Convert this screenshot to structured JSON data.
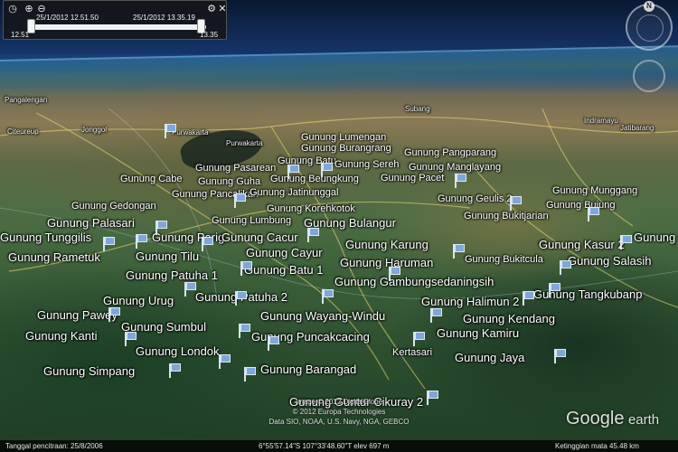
{
  "time_slider": {
    "start_datetime": "25/1/2012  12.51.50",
    "end_datetime": "25/1/2012  13.35.19",
    "start_time": "12.51",
    "end_time": "13.35",
    "range_fraction": [
      0.0,
      1.0
    ],
    "icons": [
      "clock-icon",
      "zoom-in-icon",
      "zoom-out-icon",
      "settings-icon",
      "close-icon"
    ]
  },
  "navigation": {
    "north_label": "N"
  },
  "place_names": {
    "pangalengan": "Pangalengan",
    "cileungsi": "Citeureup",
    "jonggol": "Jonggol",
    "purwakarta": "Purwakarta",
    "subang": "Subang",
    "indramayu": "Indramayu",
    "jatibarang": "Jatibarang",
    "kertasari": "Kertasari"
  },
  "mountains": [
    "Gunung Lumengan",
    "Gunung Burangrang",
    "Gunung Pangparang",
    "Gunung Batu",
    "Gunung Pasarean",
    "Gunung Sereh",
    "Gunung Manglayang",
    "Gunung Cabe",
    "Gunung Guha",
    "Gunung Beungkung",
    "Gunung Pacet",
    "Gunung Pancalikan",
    "Gunung Jatinunggal",
    "Gunung Geulis 2",
    "Gunung Munggang",
    "Gunung Gedongan",
    "Gunung Korehkotok",
    "Gunung Bujung",
    "Gunung Bukitjarian",
    "Gunung Palasari",
    "Gunung Lumbung",
    "Gunung Bulangur",
    "Gunung Tunggilis",
    "Gunung Parig",
    "Gunung Cacur",
    "Gunung Karung",
    "Gunung Kasur 2",
    "Gunung Ma",
    "Gunung Rametuk",
    "Gunung Tilu",
    "Gunung Cayur",
    "Gunung Haruman",
    "Gunung Bukitcula",
    "Gunung Salasih",
    "Gunung Patuha 1",
    "Gunung Batu 1",
    "Gunung Gambungsedaningsih",
    "Gunung Urug",
    "Gunung Patuha 2",
    "Gunung Halimun 2",
    "Gunung Tangkubanp",
    "Gunung Pawey",
    "Gunung Wayang-Windu",
    "Gunung Kendang",
    "Gunung Sumbul",
    "Gunung Kanti",
    "Gunung Puncakcacing",
    "Gunung Kamiru",
    "Gunung Londok",
    "Kertasari",
    "Gunung Jaya",
    "Gunung Simpang",
    "Gunung Barangad",
    "Gunung Guntur Cikuray 2"
  ],
  "credits": {
    "line1": "Image © 2012 DigitalGlobe",
    "line2": "© 2012 Europa Technologies",
    "line3": "Data SIO, NOAA, U.S. Navy, NGA, GEBCO"
  },
  "status_bar": {
    "imagery_date": "Tanggal pencitraan: 25/8/2006",
    "coordinates": "6°55'57.14\"S  107°33'48.60\"T  elev   697 m",
    "eye_alt": "Ketinggian mata    45.48 km"
  },
  "logo": {
    "google": "Google",
    "earth": "earth"
  },
  "colors": {
    "pin_fill": "#7fa7d8",
    "label_text": "#ffffff"
  }
}
